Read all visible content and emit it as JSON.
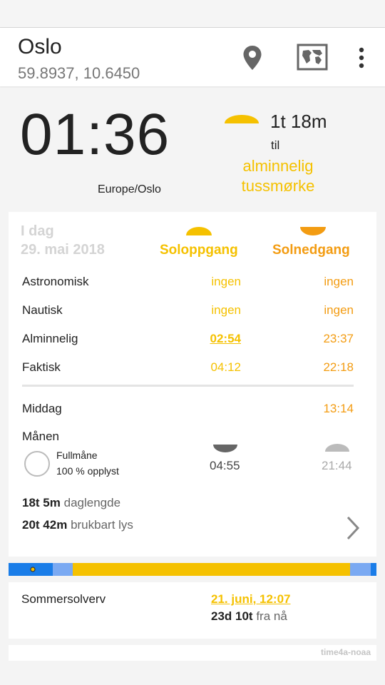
{
  "header": {
    "city": "Oslo",
    "coordinates": "59.8937, 10.6450",
    "icons": [
      "location-pin-icon",
      "map-icon",
      "more-vert-icon"
    ]
  },
  "now": {
    "time": "01:36",
    "timezone": "Europe/Oslo",
    "countdown": "1t 18m",
    "til": "til",
    "next_event_line1": "alminnelig",
    "next_event_line2": "tussmørke"
  },
  "today": {
    "label": "I dag",
    "date": "29. mai 2018",
    "sunrise_header": "Soloppgang",
    "sunset_header": "Solnedgang",
    "rows": [
      {
        "label": "Astronomisk",
        "rise": "ingen",
        "set": "ingen"
      },
      {
        "label": "Nautisk",
        "rise": "ingen",
        "set": "ingen"
      },
      {
        "label": "Alminnelig",
        "rise": "02:54",
        "set": "23:37"
      },
      {
        "label": "Faktisk",
        "rise": "04:12",
        "set": "22:18"
      }
    ],
    "noon_label": "Middag",
    "noon_time": "13:14",
    "moon_label": "Månen",
    "moon_phase": "Fullmåne",
    "moon_illumination": "100 % opplyst",
    "moonrise": "04:55",
    "moonset": "21:44",
    "day_length": "18t 5m",
    "day_length_label": "daglengde",
    "usable_light": "20t 42m",
    "usable_light_label": "brukbart lys"
  },
  "colors": {
    "sun_yellow": "#f5c100",
    "sun_orange": "#f39c12",
    "night_blue": "#1a7de8",
    "twilight_blue": "#7aa9f2",
    "muted": "#d4d4d4"
  },
  "next_event": {
    "label": "Sommersolverv",
    "date": "21. juni, 12:07",
    "relative_bold": "23d 10t",
    "relative_rest": "fra nå"
  },
  "footer": {
    "source": "time4a-noaa"
  }
}
